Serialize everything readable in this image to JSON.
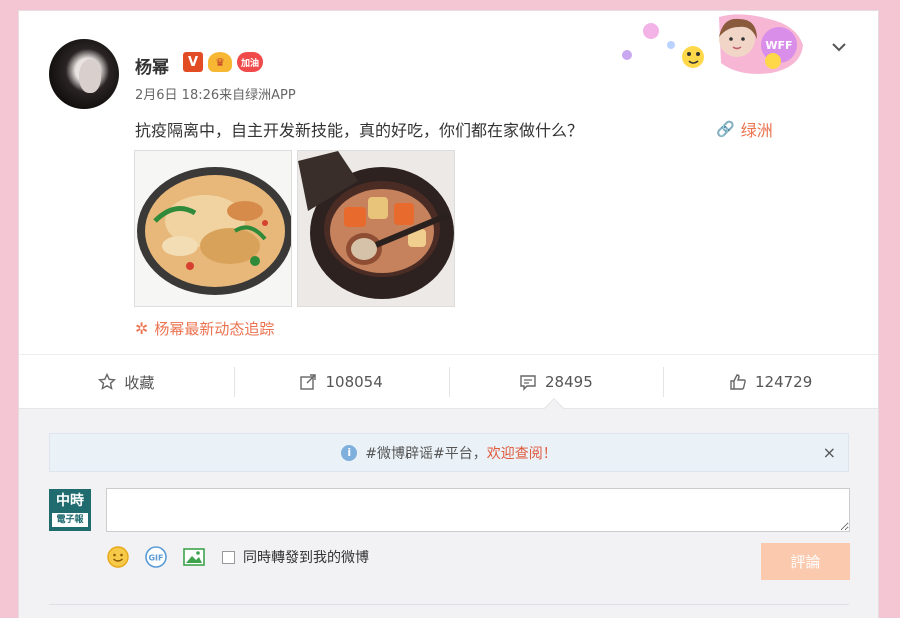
{
  "post": {
    "username": "杨幂",
    "badge_v": "V",
    "meta": "2月6日 18:26来自绿洲APP",
    "text": "抗疫隔离中，自主开发新技能，真的好吃，你们都在家做什么？",
    "link_label": "绿洲",
    "tracker": "杨幂最新动态追踪",
    "badge_heart": "加油"
  },
  "actions": {
    "favorite_label": "收藏",
    "repost_count": "108054",
    "comment_count": "28495",
    "like_count": "124729"
  },
  "comment": {
    "notice_prefix": "#微博辟谣#平台，",
    "notice_highlight": "欢迎查阅！",
    "notice_close": "×",
    "logo_line1": "中時",
    "logo_line2": "電子報",
    "input_value": "",
    "repost_checkbox_label": "同時轉發到我的微博",
    "submit_label": "評論"
  },
  "colors": {
    "background": "#f4c6d3",
    "accent": "#eb7350",
    "submit_disabled": "#fbc9ad"
  }
}
